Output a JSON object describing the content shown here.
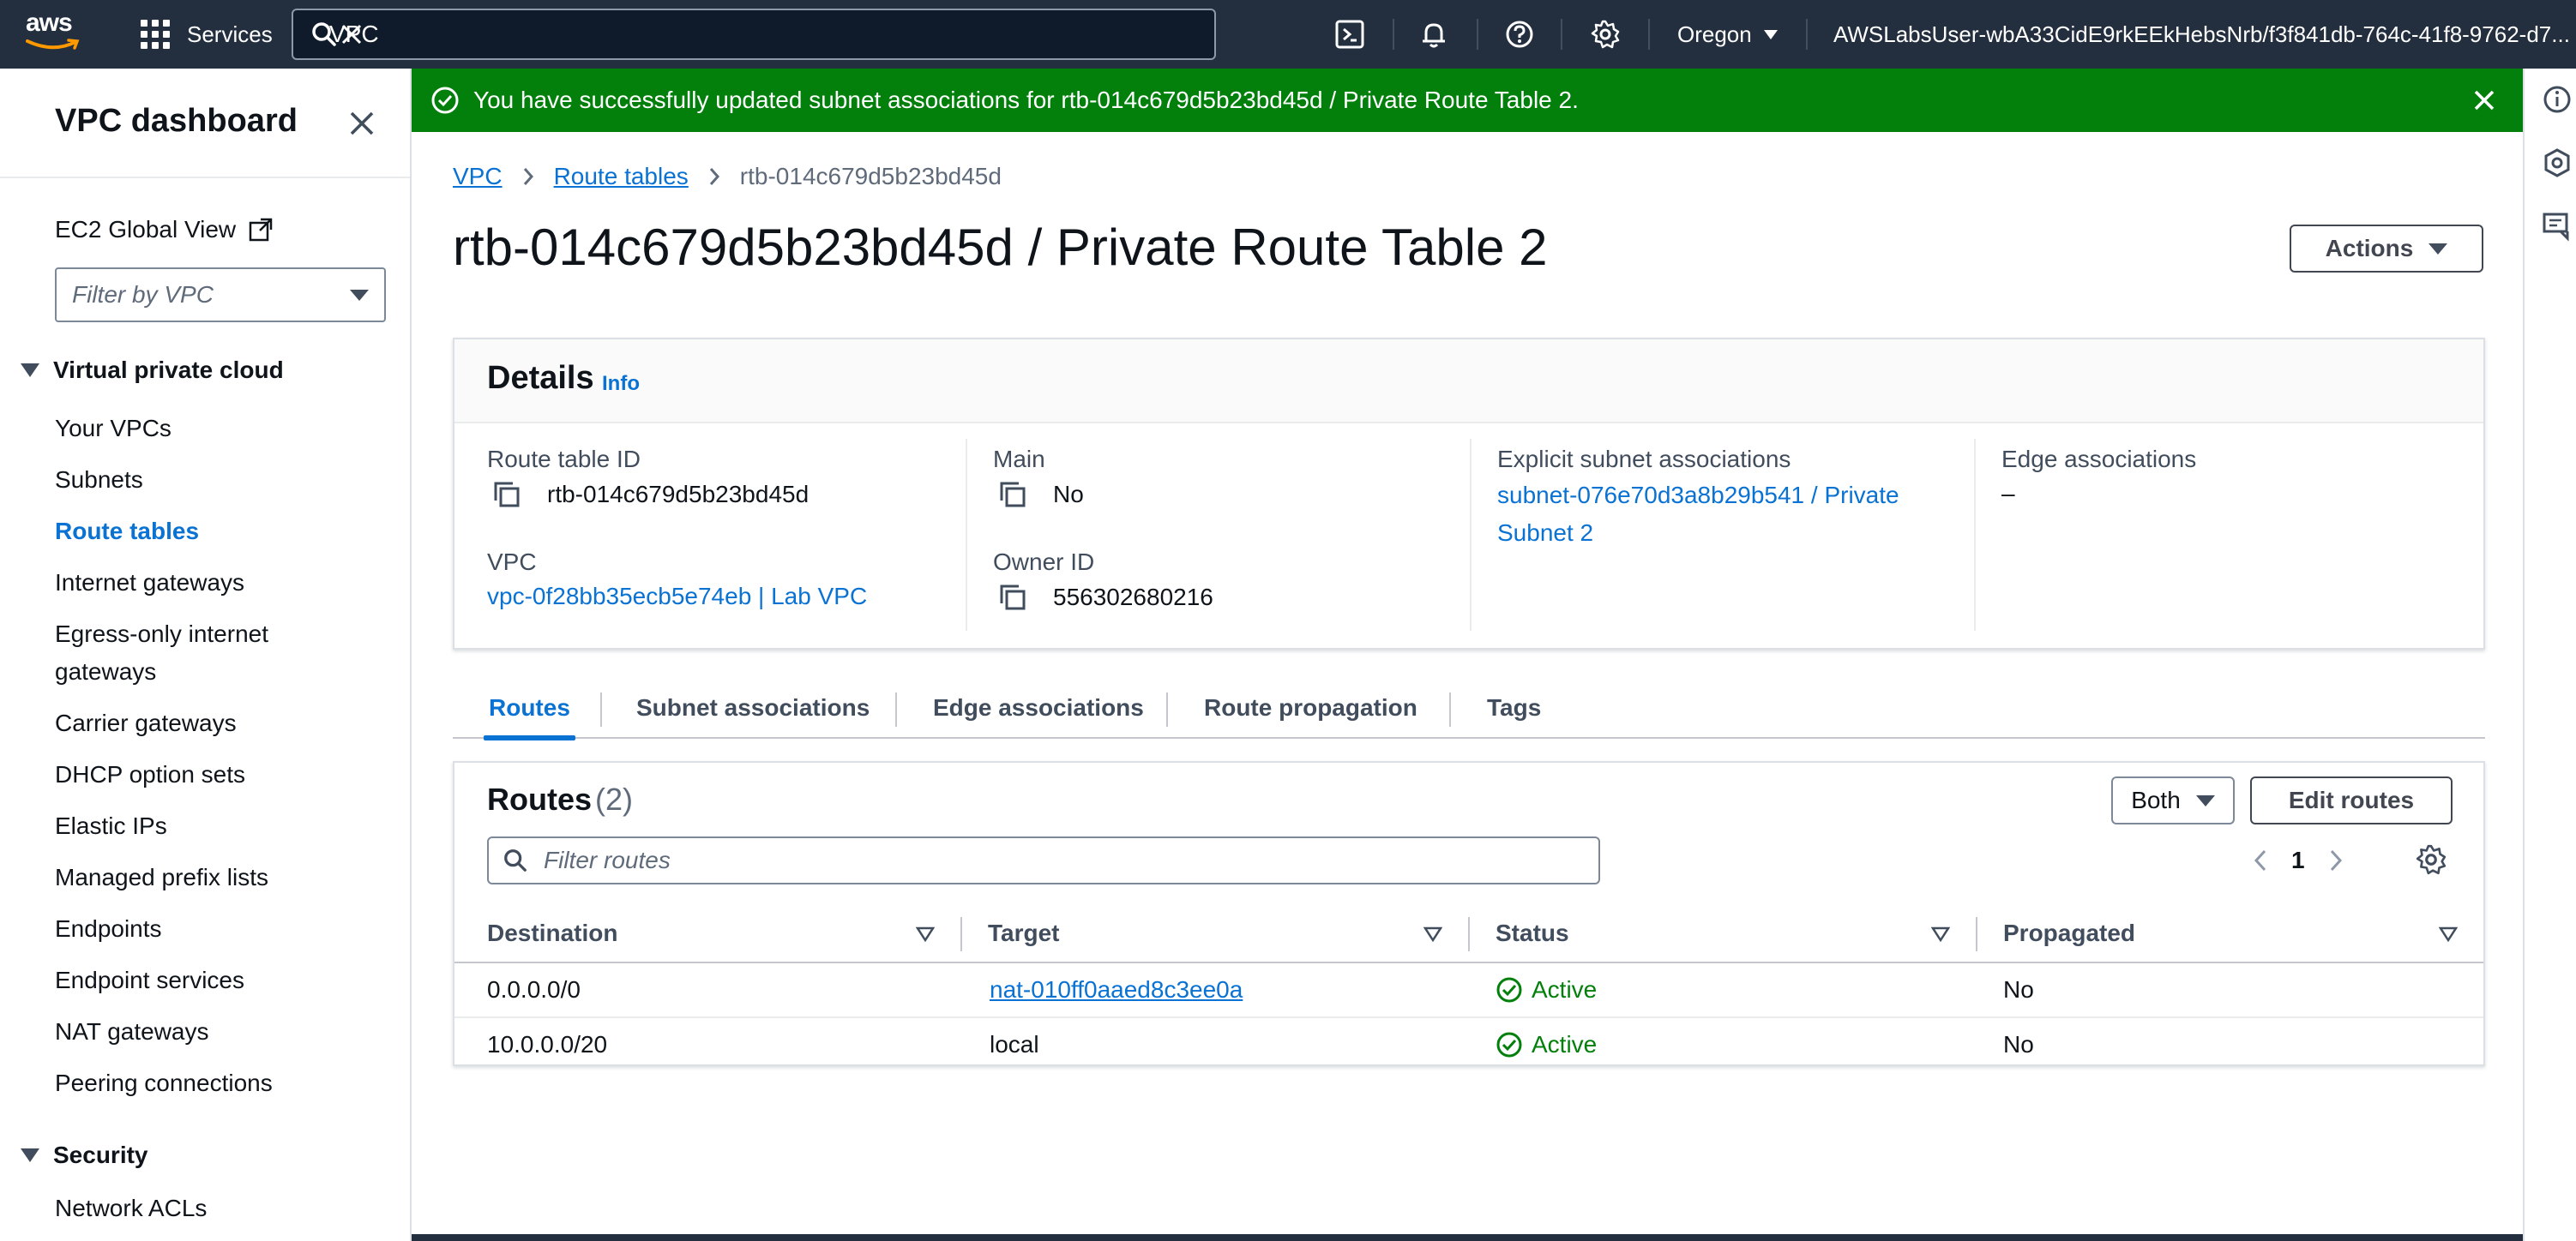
{
  "topnav": {
    "logo_text": "aws",
    "services_label": "Services",
    "search_value": "VPC",
    "region": "Oregon",
    "user": "AWSLabsUser-wbA33CidE9rkEEkHebsNrb/f3f841db-764c-41f8-9762-d7..."
  },
  "sidebar": {
    "title": "VPC dashboard",
    "ec2_global_view": "EC2 Global View",
    "vpc_filter_placeholder": "Filter by VPC",
    "section_vpc": "Virtual private cloud",
    "items": [
      "Your VPCs",
      "Subnets",
      "Route tables",
      "Internet gateways",
      "Egress-only internet gateways",
      "Carrier gateways",
      "DHCP option sets",
      "Elastic IPs",
      "Managed prefix lists",
      "Endpoints",
      "Endpoint services",
      "NAT gateways",
      "Peering connections"
    ],
    "active_item": "Route tables",
    "section_security": "Security",
    "security_items": [
      "Network ACLs"
    ]
  },
  "flash": {
    "message": "You have successfully updated subnet associations for rtb-014c679d5b23bd45d / Private Route Table 2."
  },
  "breadcrumb": {
    "items": [
      "VPC",
      "Route tables"
    ],
    "current": "rtb-014c679d5b23bd45d"
  },
  "page": {
    "title": "rtb-014c679d5b23bd45d / Private Route Table 2",
    "actions_label": "Actions"
  },
  "details": {
    "title": "Details",
    "info": "Info",
    "route_table_id_label": "Route table ID",
    "route_table_id": "rtb-014c679d5b23bd45d",
    "vpc_label": "VPC",
    "vpc_value": "vpc-0f28bb35ecb5e74eb | Lab VPC",
    "main_label": "Main",
    "main_value": "No",
    "owner_label": "Owner ID",
    "owner_value": "556302680216",
    "explicit_label": "Explicit subnet associations",
    "explicit_value_line1": "subnet-076e70d3a8b29b541 / Private",
    "explicit_value_line2": "Subnet 2",
    "edge_label": "Edge associations",
    "edge_value": "–"
  },
  "tabs": [
    "Routes",
    "Subnet associations",
    "Edge associations",
    "Route propagation",
    "Tags"
  ],
  "routes": {
    "title": "Routes",
    "count": "(2)",
    "filter_selected": "Both",
    "edit_label": "Edit routes",
    "filter_placeholder": "Filter routes",
    "page_number": "1",
    "columns": [
      "Destination",
      "Target",
      "Status",
      "Propagated"
    ],
    "rows": [
      {
        "destination": "0.0.0.0/0",
        "target": "nat-010ff0aaed8c3ee0a",
        "status": "Active",
        "propagated": "No"
      },
      {
        "destination": "10.0.0.0/20",
        "target": "local",
        "status": "Active",
        "propagated": "No"
      }
    ]
  },
  "colors": {
    "nav_bg": "#232f3e",
    "link": "#0972d3",
    "success": "#037f0c"
  }
}
